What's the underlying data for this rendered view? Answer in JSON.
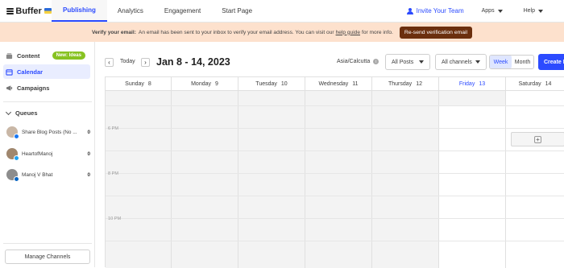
{
  "app": {
    "logo_text": "Buffer"
  },
  "nav": {
    "tabs": [
      "Publishing",
      "Analytics",
      "Engagement",
      "Start Page"
    ],
    "invite": "Invite Your Team",
    "apps": "Apps",
    "help": "Help"
  },
  "banner": {
    "bold": "Verify your email:",
    "text": "An email has been sent to your inbox to verify your email address. You can visit our",
    "link": "help guide",
    "text_after": "for more info.",
    "button": "Re-send verification email"
  },
  "sidebar": {
    "content": "Content",
    "new_ideas": "New: Ideas",
    "calendar": "Calendar",
    "campaigns": "Campaigns",
    "queues_heading": "Queues",
    "queues": [
      {
        "name": "Share Blog Posts (No ...",
        "count": "0",
        "network": "facebook",
        "net_color": "#1877f2"
      },
      {
        "name": "HeartofManoj",
        "count": "0",
        "network": "twitter",
        "net_color": "#1da1f2"
      },
      {
        "name": "Manoj V Bhat",
        "count": "0",
        "network": "linkedin",
        "net_color": "#0a66c2"
      }
    ],
    "manage_channels": "Manage Channels"
  },
  "toolbar": {
    "prev_icon": "‹",
    "today": "Today",
    "next_icon": "›",
    "date_range": "Jan 8 - 14, 2023",
    "timezone": "Asia/Calcutta",
    "all_posts": "All Posts",
    "all_channels": "All channels",
    "week": "Week",
    "month": "Month",
    "create": "Create Post"
  },
  "calendar": {
    "days": [
      {
        "name": "Sunday",
        "num": "8"
      },
      {
        "name": "Monday",
        "num": "9"
      },
      {
        "name": "Tuesday",
        "num": "10"
      },
      {
        "name": "Wednesday",
        "num": "11"
      },
      {
        "name": "Thursday",
        "num": "12"
      },
      {
        "name": "Friday",
        "num": "13"
      },
      {
        "name": "Saturday",
        "num": "14"
      }
    ],
    "time_labels": [
      "6 PM",
      "8 PM",
      "10 PM"
    ]
  },
  "colors": {
    "accent": "#2c4bff",
    "banner_bg": "#fde1cd",
    "banner_button": "#6b2f0e",
    "badge": "#87c221"
  }
}
